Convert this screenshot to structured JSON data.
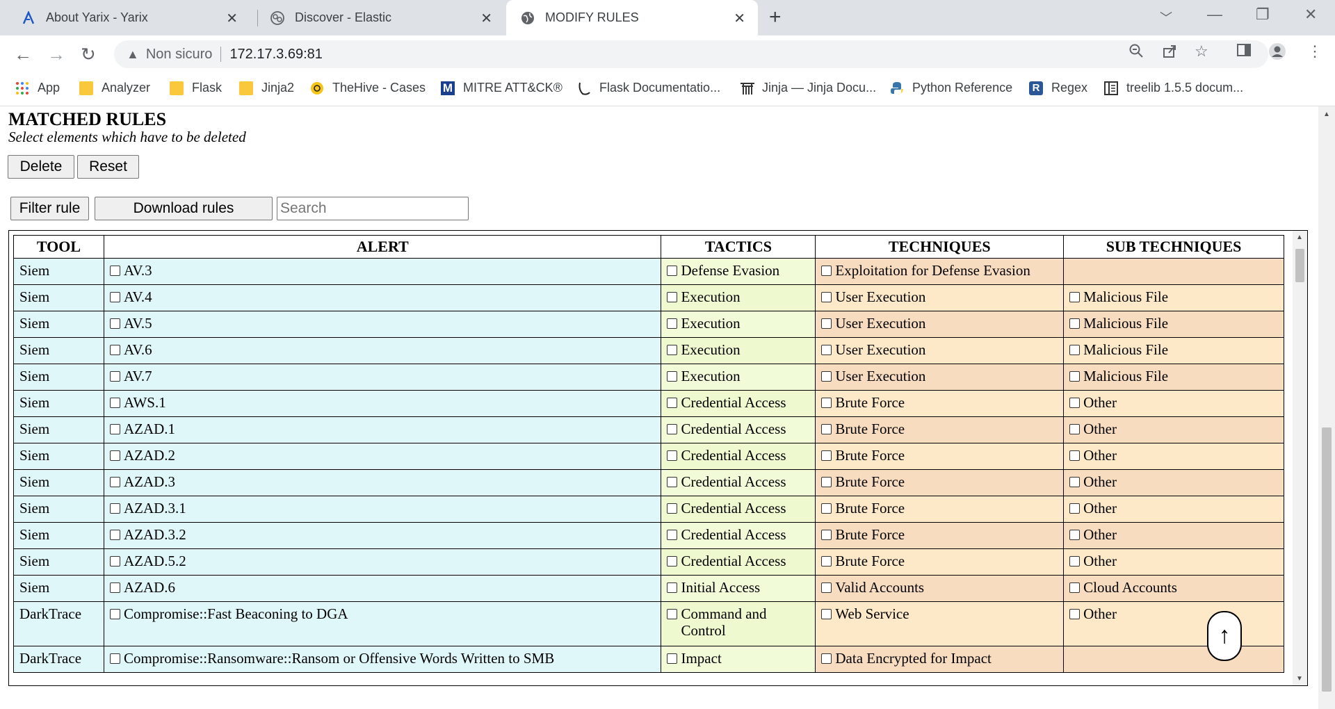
{
  "browser": {
    "tabs": [
      {
        "title": "About Yarix - Yarix",
        "icon": "yarix-logo-icon"
      },
      {
        "title": "Discover - Elastic",
        "icon": "elastic-logo-icon"
      },
      {
        "title": "MODIFY RULES",
        "icon": "globe-icon"
      }
    ],
    "address": {
      "security_label": "Non sicuro",
      "url": "172.17.3.69:81"
    },
    "bookmarks": [
      {
        "label": "App",
        "icon": "apps-grid-icon"
      },
      {
        "label": "Analyzer",
        "icon": "folder-icon"
      },
      {
        "label": "Flask",
        "icon": "folder-icon"
      },
      {
        "label": "Jinja2",
        "icon": "folder-icon"
      },
      {
        "label": "TheHive - Cases",
        "icon": "thehive-icon"
      },
      {
        "label": "MITRE ATT&CK®",
        "icon": "mitre-icon"
      },
      {
        "label": "Flask Documentatio...",
        "icon": "flask-icon"
      },
      {
        "label": "Jinja — Jinja Docu...",
        "icon": "jinja-icon"
      },
      {
        "label": "Python Reference",
        "icon": "python-icon"
      },
      {
        "label": "Regex",
        "icon": "regex-icon"
      },
      {
        "label": "treelib 1.5.5 docum...",
        "icon": "docs-icon"
      }
    ]
  },
  "page": {
    "title": "MATCHED RULES",
    "subtitle": "Select elements which have to be deleted",
    "delete_label": "Delete",
    "reset_label": "Reset",
    "filter_label": "Filter rule",
    "download_label": "Download rules",
    "search_placeholder": "Search",
    "to_top_label": "↑"
  },
  "table": {
    "headers": {
      "tool": "TOOL",
      "alert": "ALERT",
      "tactics": "TACTICS",
      "techniques": "TECHNIQUES",
      "sub_techniques": "SUB TECHNIQUES"
    },
    "rows": [
      {
        "tool": "Siem",
        "alert": "AV.3",
        "tactic": "Defense Evasion",
        "technique": "Exploitation for Defense Evasion",
        "sub": ""
      },
      {
        "tool": "Siem",
        "alert": "AV.4",
        "tactic": "Execution",
        "technique": "User Execution",
        "sub": "Malicious File"
      },
      {
        "tool": "Siem",
        "alert": "AV.5",
        "tactic": "Execution",
        "technique": "User Execution",
        "sub": "Malicious File"
      },
      {
        "tool": "Siem",
        "alert": "AV.6",
        "tactic": "Execution",
        "technique": "User Execution",
        "sub": "Malicious File"
      },
      {
        "tool": "Siem",
        "alert": "AV.7",
        "tactic": "Execution",
        "technique": "User Execution",
        "sub": "Malicious File"
      },
      {
        "tool": "Siem",
        "alert": "AWS.1",
        "tactic": "Credential Access",
        "technique": "Brute Force",
        "sub": "Other"
      },
      {
        "tool": "Siem",
        "alert": "AZAD.1",
        "tactic": "Credential Access",
        "technique": "Brute Force",
        "sub": "Other"
      },
      {
        "tool": "Siem",
        "alert": "AZAD.2",
        "tactic": "Credential Access",
        "technique": "Brute Force",
        "sub": "Other"
      },
      {
        "tool": "Siem",
        "alert": "AZAD.3",
        "tactic": "Credential Access",
        "technique": "Brute Force",
        "sub": "Other"
      },
      {
        "tool": "Siem",
        "alert": "AZAD.3.1",
        "tactic": "Credential Access",
        "technique": "Brute Force",
        "sub": "Other"
      },
      {
        "tool": "Siem",
        "alert": "AZAD.3.2",
        "tactic": "Credential Access",
        "technique": "Brute Force",
        "sub": "Other"
      },
      {
        "tool": "Siem",
        "alert": "AZAD.5.2",
        "tactic": "Credential Access",
        "technique": "Brute Force",
        "sub": "Other"
      },
      {
        "tool": "Siem",
        "alert": "AZAD.6",
        "tactic": "Initial Access",
        "technique": "Valid Accounts",
        "sub": "Cloud Accounts"
      },
      {
        "tool": "DarkTrace",
        "alert": "Compromise::Fast Beaconing to DGA",
        "tactic": "Command and Control",
        "technique": "Web Service",
        "sub": "Other"
      },
      {
        "tool": "DarkTrace",
        "alert": "Compromise::Ransomware::Ransom or Offensive Words Written to SMB",
        "tactic": "Impact",
        "technique": "Data Encrypted for Impact",
        "sub": ""
      }
    ]
  }
}
